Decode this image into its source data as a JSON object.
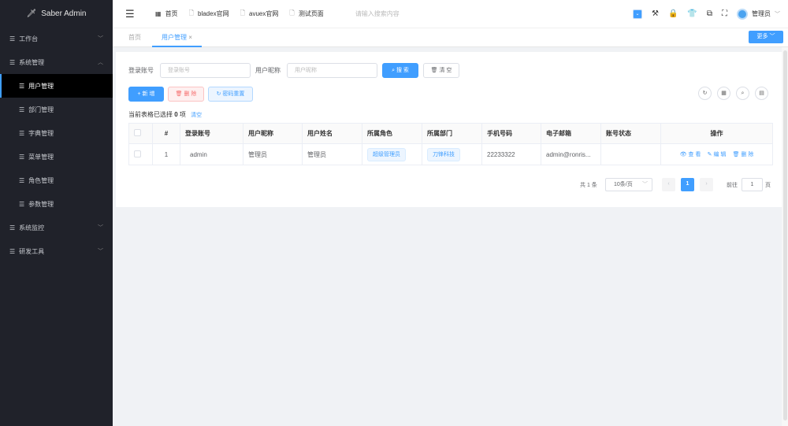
{
  "app": {
    "title": "Saber Admin"
  },
  "sidebar": {
    "items": [
      {
        "label": "工作台",
        "level": 1,
        "expanded": false
      },
      {
        "label": "系统管理",
        "level": 1,
        "expanded": true
      },
      {
        "label": "用户管理",
        "level": 2,
        "active": true
      },
      {
        "label": "部门管理",
        "level": 2
      },
      {
        "label": "字典管理",
        "level": 2
      },
      {
        "label": "菜单管理",
        "level": 2
      },
      {
        "label": "角色管理",
        "level": 2
      },
      {
        "label": "参数管理",
        "level": 2
      },
      {
        "label": "系统监控",
        "level": 1,
        "expanded": false
      },
      {
        "label": "研发工具",
        "level": 1,
        "expanded": false
      }
    ]
  },
  "header": {
    "links": [
      "首页",
      "bladex官网",
      "avuex官网",
      "测试页面"
    ],
    "search_placeholder": "请输入搜索内容",
    "user": "管理员"
  },
  "tabs": {
    "items": [
      "首页",
      "用户管理"
    ],
    "more": "更多"
  },
  "search": {
    "account_label": "登录账号",
    "account_placeholder": "登录账号",
    "nickname_label": "用户昵称",
    "nickname_placeholder": "用户昵称",
    "search_btn": "搜 索",
    "clear_btn": "清 空"
  },
  "toolbar": {
    "add": "新 增",
    "delete": "删 除",
    "reset_pwd": "密码重置"
  },
  "selection": {
    "prefix": "当前表格已选择",
    "count": "0",
    "suffix": "项",
    "clear": "清空"
  },
  "table": {
    "columns": [
      "#",
      "登录账号",
      "用户昵称",
      "用户姓名",
      "所属角色",
      "所属部门",
      "手机号码",
      "电子邮箱",
      "账号状态",
      "操作"
    ],
    "rows": [
      {
        "index": "1",
        "account": "admin",
        "nickname": "管理员",
        "name": "管理员",
        "role": "超级管理员",
        "dept": "刀锋科技",
        "phone": "22233322",
        "email": "admin@ronris...",
        "status": ""
      }
    ],
    "actions": {
      "view": "查 看",
      "edit": "编 辑",
      "delete": "删 除"
    }
  },
  "pagination": {
    "total": "共 1 条",
    "page_size": "10条/页",
    "current": "1",
    "goto_label": "前往",
    "goto_value": "1",
    "goto_suffix": "页"
  },
  "colors": {
    "accent": "#409eff",
    "sidebar": "#20222a",
    "danger": "#f56c6c"
  }
}
